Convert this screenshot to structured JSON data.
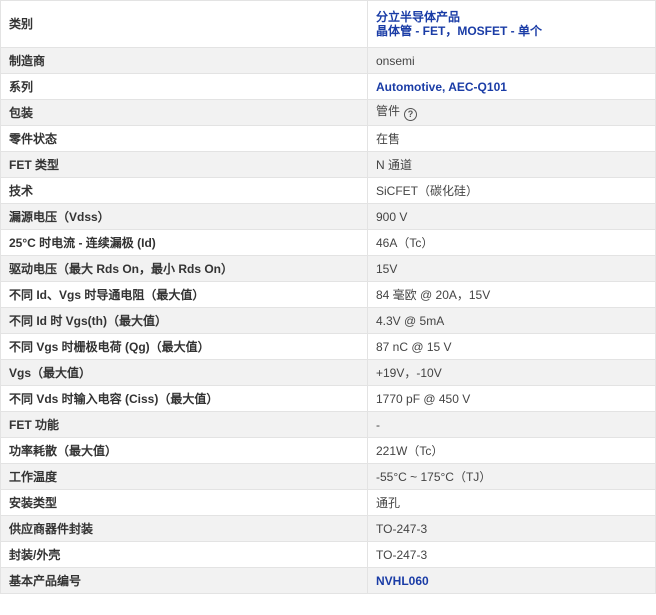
{
  "rows": [
    {
      "label": "类别",
      "value_lines": [
        "分立半导体产品",
        "晶体管 - FET，MOSFET - 单个"
      ]
    },
    {
      "label": "制造商",
      "value": "onsemi"
    },
    {
      "label": "系列",
      "value": "Automotive, AEC-Q101"
    },
    {
      "label": "包装",
      "value": "管件"
    },
    {
      "label": "零件状态",
      "value": "在售"
    },
    {
      "label": "FET 类型",
      "value": "N 通道"
    },
    {
      "label": "技术",
      "value": "SiCFET（碳化硅）"
    },
    {
      "label": "漏源电压（Vdss）",
      "value": "900 V"
    },
    {
      "label": "25°C 时电流 - 连续漏极 (Id)",
      "value": "46A（Tc）"
    },
    {
      "label": "驱动电压（最大 Rds On，最小 Rds On）",
      "value": "15V"
    },
    {
      "label": "不同 Id、Vgs 时导通电阻（最大值）",
      "value": "84 毫欧 @ 20A，15V"
    },
    {
      "label": "不同 Id 时 Vgs(th)（最大值）",
      "value": "4.3V @ 5mA"
    },
    {
      "label": "不同 Vgs 时栅极电荷 (Qg)（最大值）",
      "value": "87 nC @ 15 V"
    },
    {
      "label": "Vgs（最大值）",
      "value": "+19V，-10V"
    },
    {
      "label": "不同 Vds 时输入电容 (Ciss)（最大值）",
      "value": "1770 pF @ 450 V"
    },
    {
      "label": "FET 功能",
      "value": "-"
    },
    {
      "label": "功率耗散（最大值）",
      "value": "221W（Tc）"
    },
    {
      "label": "工作温度",
      "value": "-55°C ~ 175°C（TJ）"
    },
    {
      "label": "安装类型",
      "value": "通孔"
    },
    {
      "label": "供应商器件封装",
      "value": "TO-247-3"
    },
    {
      "label": "封装/外壳",
      "value": "TO-247-3"
    },
    {
      "label": "基本产品编号",
      "value": "NVHL060"
    }
  ],
  "help_icon": {
    "name": "question-circle-icon",
    "glyph": "?"
  },
  "colors": {
    "link": "#1a3ca6",
    "row_alt": "#f2f2f2",
    "border": "#e3e3e3"
  }
}
